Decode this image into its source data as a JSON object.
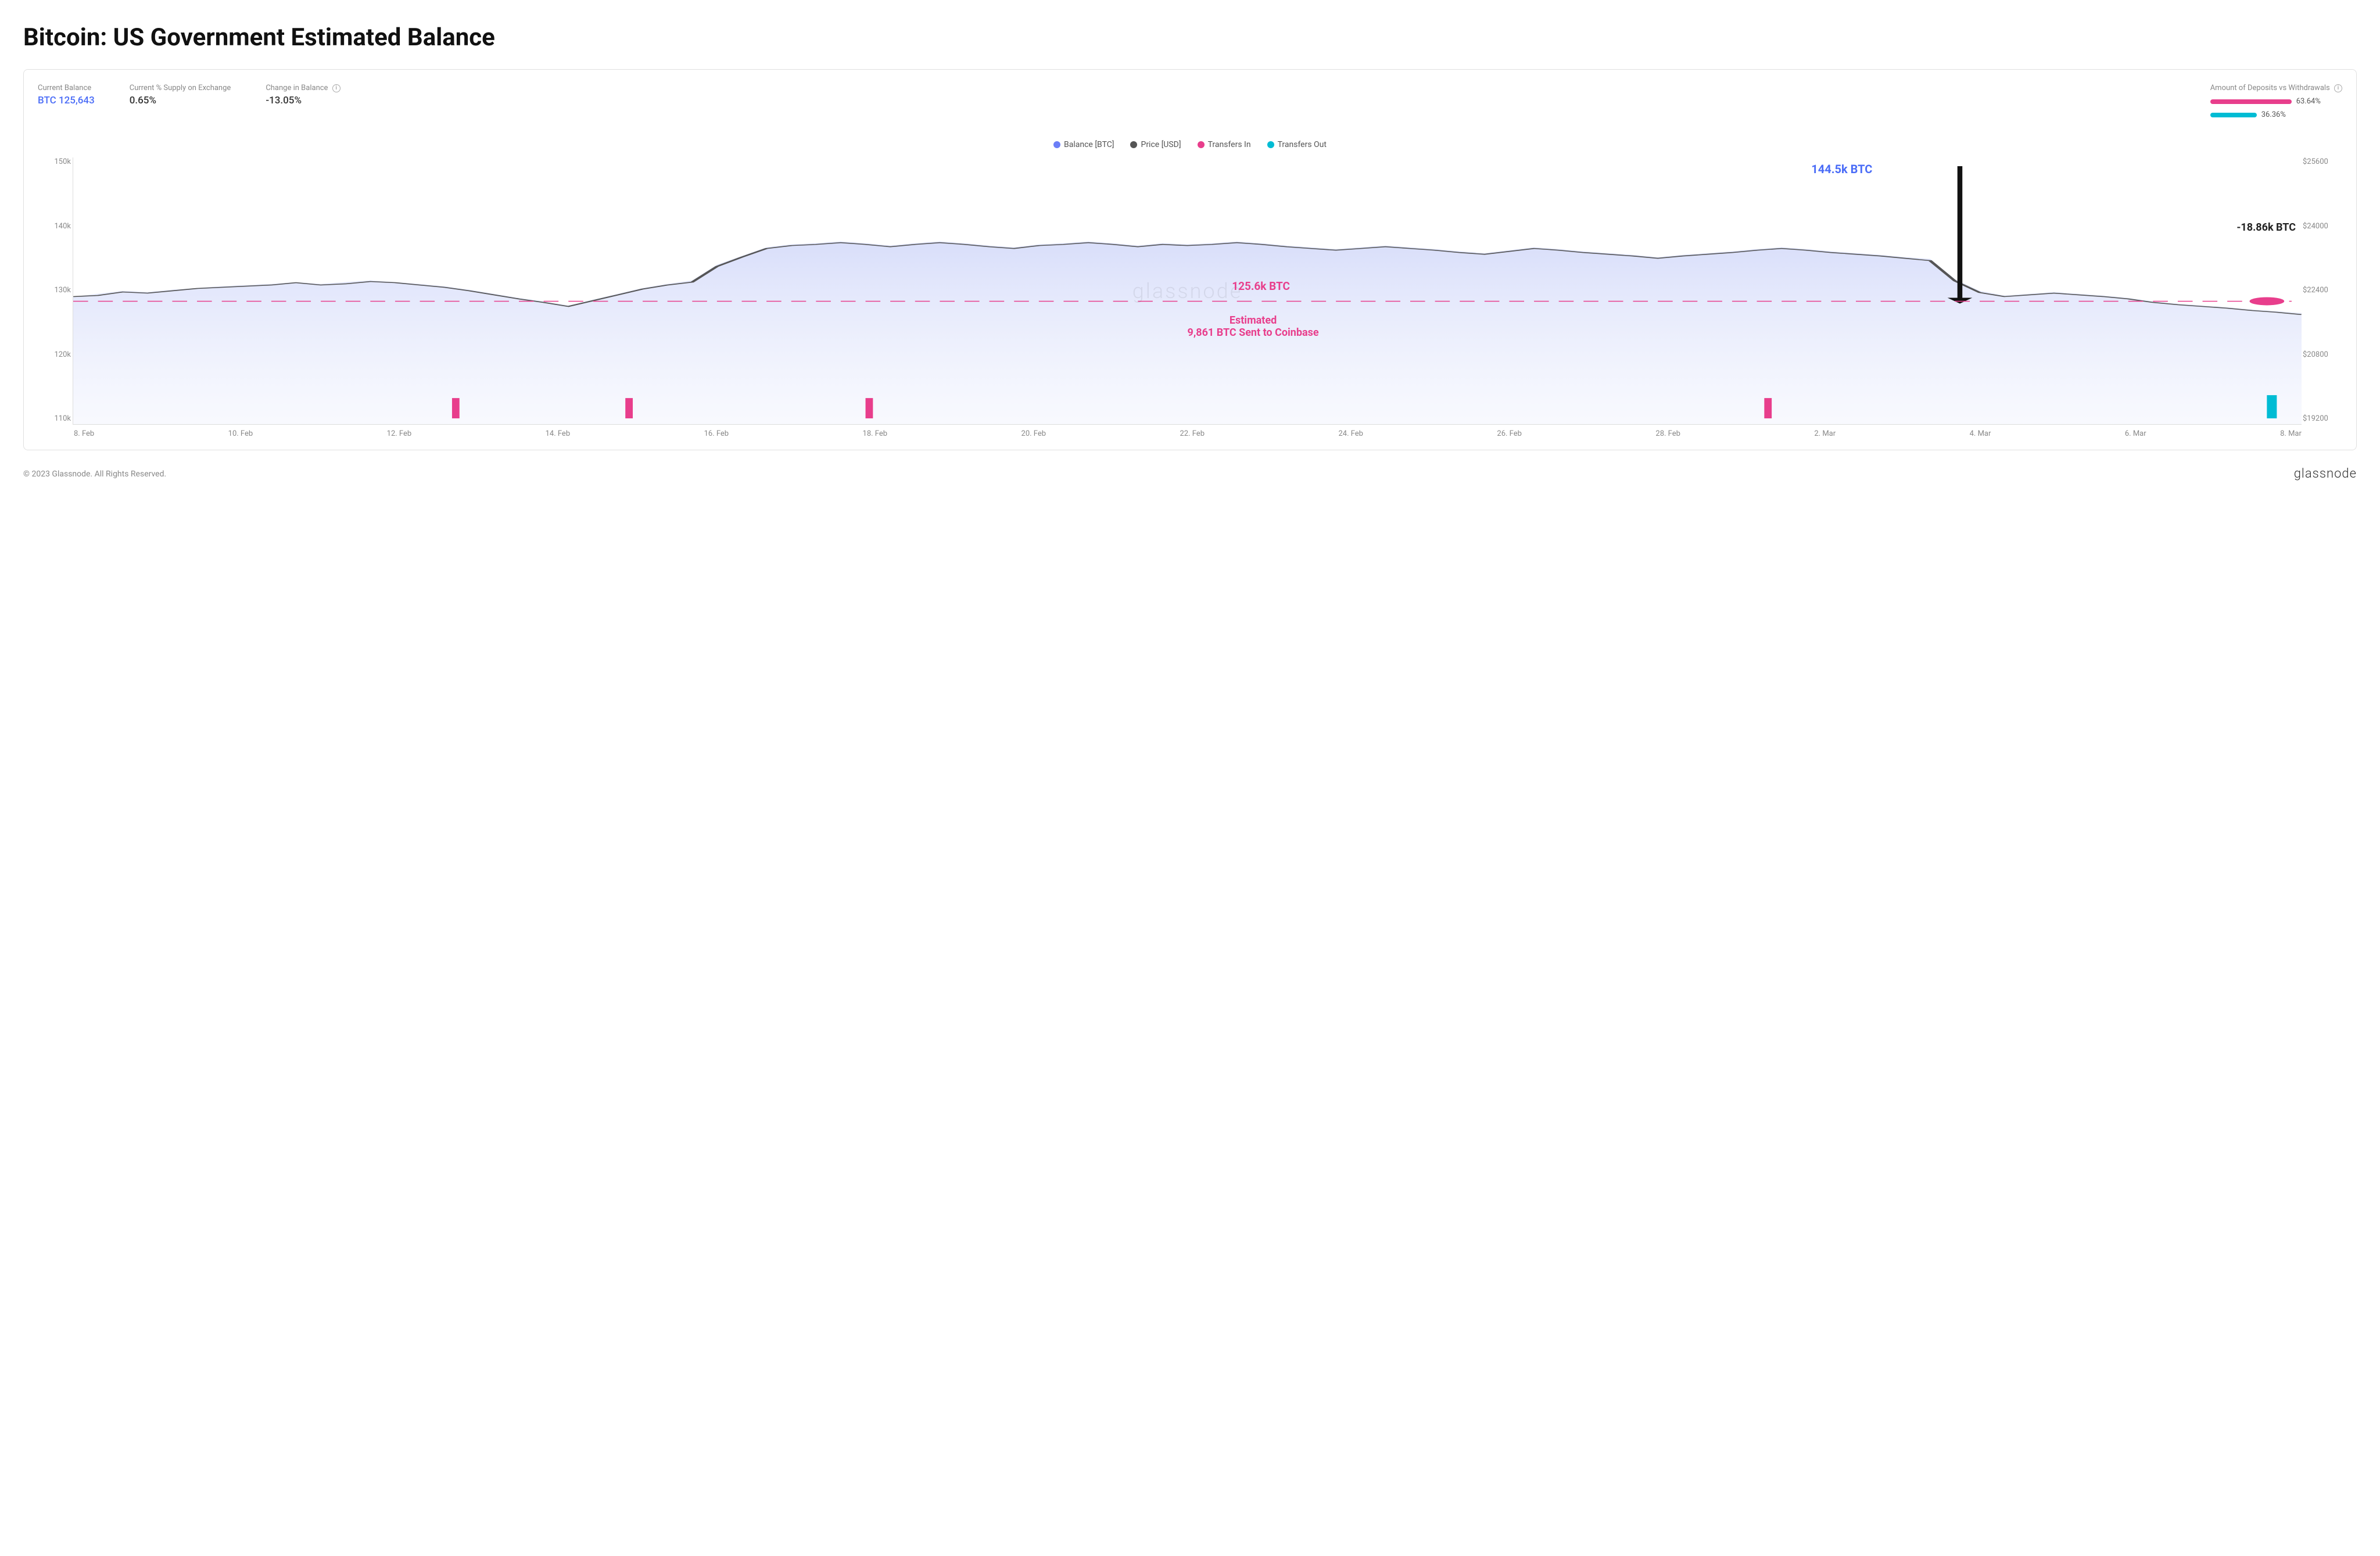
{
  "page": {
    "title": "Bitcoin: US Government Estimated Balance"
  },
  "stats": {
    "current_balance_label": "Current Balance",
    "current_balance_value": "BTC 125,643",
    "supply_label": "Current % Supply on Exchange",
    "supply_value": "0.65%",
    "change_label": "Change in Balance",
    "change_value": "-13.05%",
    "deposits_label": "Amount of Deposits vs Withdrawals",
    "deposit_pct": "63.64%",
    "withdrawal_pct": "36.36%"
  },
  "legend": [
    {
      "label": "Balance [BTC]",
      "color": "#6b7ef7",
      "type": "dot"
    },
    {
      "label": "Price [USD]",
      "color": "#555",
      "type": "dot"
    },
    {
      "label": "Transfers In",
      "color": "#e83e8c",
      "type": "dot"
    },
    {
      "label": "Transfers Out",
      "color": "#00bcd4",
      "type": "dot"
    }
  ],
  "y_axis_left": [
    "150k",
    "140k",
    "130k",
    "120k",
    "110k"
  ],
  "y_axis_right": [
    "$25600",
    "$24000",
    "$22400",
    "$20800",
    "$19200"
  ],
  "x_axis": [
    "8. Feb",
    "10. Feb",
    "12. Feb",
    "14. Feb",
    "16. Feb",
    "18. Feb",
    "20. Feb",
    "22. Feb",
    "24. Feb",
    "26. Feb",
    "28. Feb",
    "2. Mar",
    "4. Mar",
    "6. Mar",
    "8. Mar"
  ],
  "annotations": {
    "peak": "144.5k BTC",
    "change": "-18.86k BTC",
    "current": "125.6k BTC",
    "estimated_line1": "Estimated",
    "estimated_line2": "9,861 BTC Sent to Coinbase"
  },
  "watermark": "glassnode",
  "footer": {
    "copyright": "© 2023 Glassnode. All Rights Reserved.",
    "logo": "glassnode"
  }
}
